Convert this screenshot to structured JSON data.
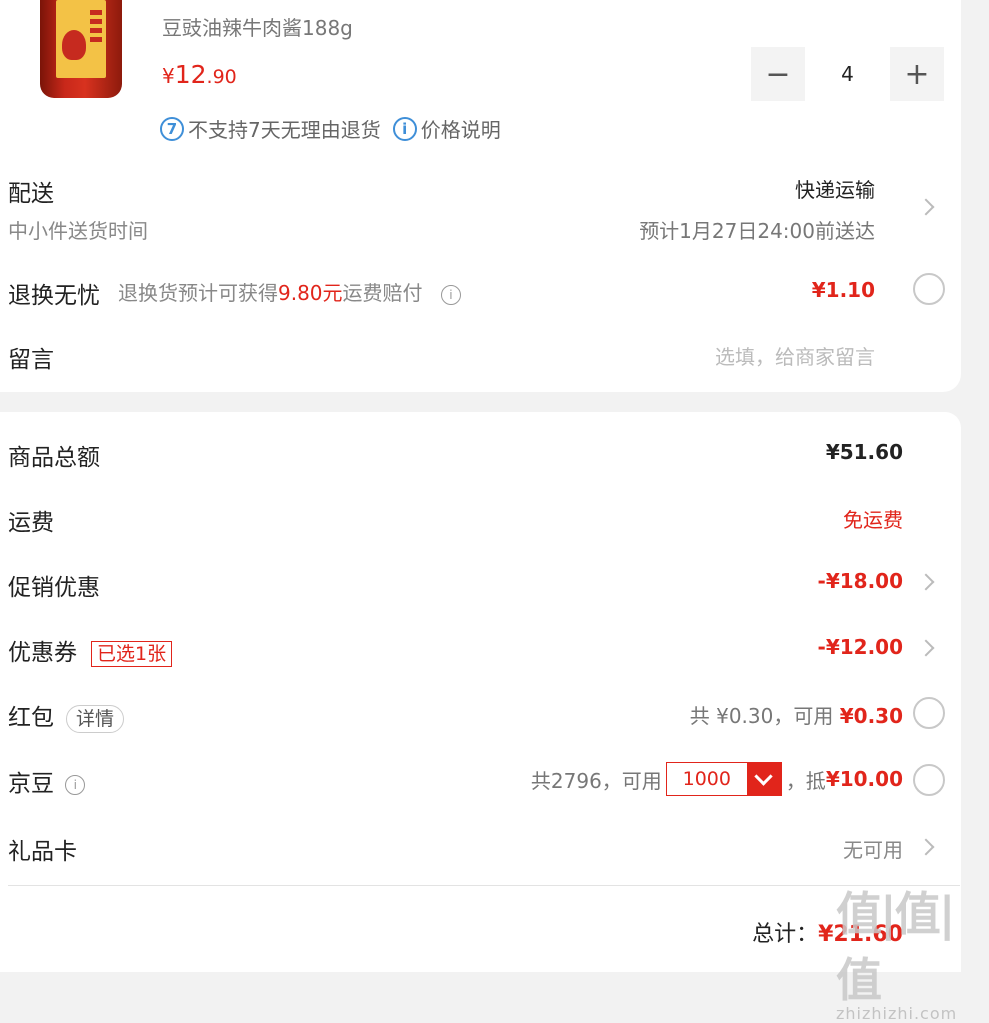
{
  "product": {
    "name": "豆豉油辣牛肉酱188g",
    "currency": "¥",
    "price_int": "12",
    "price_dec": ".90",
    "quantity": "4",
    "policy_return": "不支持7天无理由退货",
    "policy_price": "价格说明"
  },
  "delivery": {
    "label": "配送",
    "sub_label": "中小件送货时间",
    "method": "快递运输",
    "estimate": "预计1月27日24:00前送达"
  },
  "return_worry_free": {
    "label": "退换无忧",
    "desc_prefix": "退换货预计可获得",
    "desc_amount": "9.80元",
    "desc_suffix": "运费赔付",
    "price": "¥1.10"
  },
  "message": {
    "label": "留言",
    "placeholder": "选填，给商家留言"
  },
  "summary": {
    "goods_total_label": "商品总额",
    "goods_total": "¥51.60",
    "shipping_label": "运费",
    "shipping_value": "免运费",
    "promo_label": "促销优惠",
    "promo_value": "-¥18.00",
    "coupon_label": "优惠券",
    "coupon_tag": "已选1张",
    "coupon_value": "-¥12.00",
    "redpacket_label": "红包",
    "redpacket_tag": "详情",
    "redpacket_total": "共 ¥0.30，可用 ",
    "redpacket_available": "¥0.30",
    "jingdou_label": "京豆",
    "jingdou_total": "共2796，可用",
    "jingdou_amount": "1000",
    "jingdou_sep": "，抵",
    "jingdou_deduct": "¥10.00",
    "giftcard_label": "礼品卡",
    "giftcard_value": "无可用",
    "total_label": "总计：",
    "total_value": "¥21.60"
  },
  "watermark": {
    "text": "值|值|值",
    "url": "zhizhizhi.com"
  },
  "colors": {
    "accent": "#e1251b",
    "info_blue": "#3f8fd8"
  }
}
